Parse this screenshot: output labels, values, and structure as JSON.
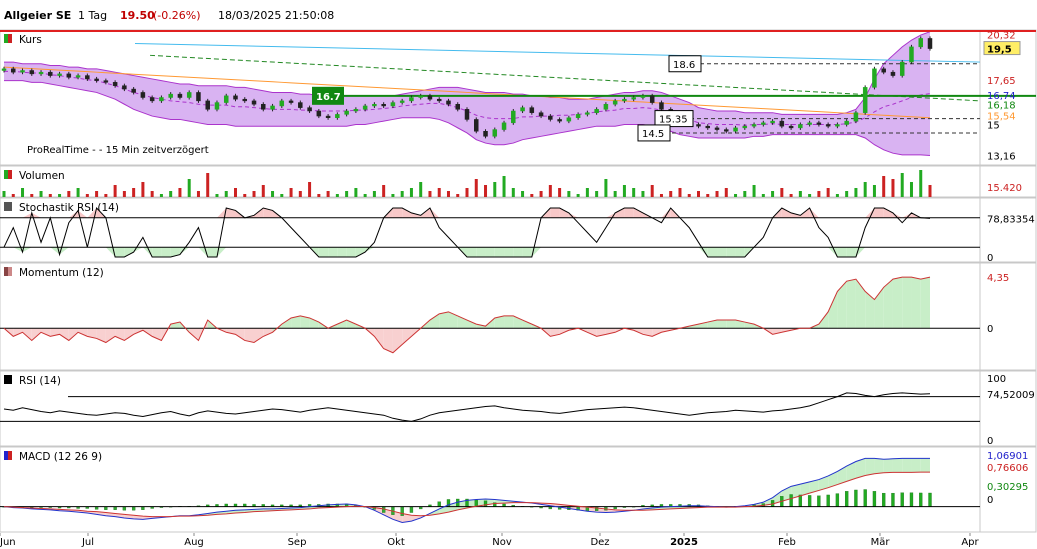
{
  "header": {
    "name": "Allgeier SE",
    "period": "1 Tag",
    "price": "19.50",
    "change": "(-0.26%)",
    "datetime": "18/03/2025 21:50:08"
  },
  "colors": {
    "up": "#22aa22",
    "down": "#cc2222",
    "bollinger_fill": "#cc99ee",
    "bollinger_line": "#aa33cc",
    "resistance": "#e02020",
    "support_green": "#118811",
    "trend_blue": "#44bbee",
    "orange_ma": "#ff9933",
    "stoch_hi_fill": "#f8c8c8",
    "stoch_lo_fill": "#c8eec8"
  },
  "chart_data": [
    {
      "type": "candlestick",
      "title": "Kurs",
      "source_note": "ProRealTime -     - 15 Min zeitverzögert",
      "x_labels": [
        "Jun",
        "Jul",
        "Aug",
        "Sep",
        "Okt",
        "Nov",
        "Dez",
        "2025",
        "Feb",
        "Mär",
        "Apr"
      ],
      "ylim": [
        12.6,
        20.6
      ],
      "y_scale_labels": [
        {
          "value": 20.32,
          "label": "20,32",
          "color": "#cc2222"
        },
        {
          "value": 19.5,
          "label": "19,5",
          "color": "#000000",
          "highlight": true
        },
        {
          "value": 17.65,
          "label": "17,65",
          "color": "#cc2222"
        },
        {
          "value": 16.74,
          "label": "16,74",
          "color": "#2222cc"
        },
        {
          "value": 16.18,
          "label": "16,18",
          "color": "#118811"
        },
        {
          "value": 15.54,
          "label": "15,54",
          "color": "#ff9933"
        },
        {
          "value": 15.0,
          "label": "15",
          "color": "#000000"
        },
        {
          "value": 13.16,
          "label": "13,16",
          "color": "#000000"
        }
      ],
      "annotations": [
        {
          "label": "16.7",
          "value": 16.7,
          "style": "green-box"
        },
        {
          "label": "18.6",
          "value": 18.6,
          "style": "box"
        },
        {
          "label": "15.35",
          "value": 15.35,
          "style": "box"
        },
        {
          "label": "14.5",
          "value": 14.5,
          "style": "box"
        }
      ],
      "lines": {
        "resistance": 20.6,
        "support": 16.7,
        "dashed_levels": [
          18.6,
          15.35,
          14.5
        ]
      },
      "close": [
        18.3,
        18.1,
        18.2,
        18.0,
        18.1,
        17.9,
        18.0,
        17.8,
        17.9,
        17.7,
        17.6,
        17.5,
        17.3,
        17.1,
        16.9,
        16.6,
        16.4,
        16.6,
        16.8,
        16.6,
        16.9,
        16.4,
        15.9,
        16.3,
        16.7,
        16.5,
        16.4,
        16.2,
        15.9,
        16.1,
        16.4,
        16.3,
        16.0,
        15.8,
        15.5,
        15.4,
        15.6,
        15.8,
        15.9,
        16.1,
        16.2,
        16.1,
        16.3,
        16.4,
        16.6,
        16.7,
        16.5,
        16.4,
        16.2,
        15.9,
        15.3,
        14.6,
        14.3,
        14.7,
        15.1,
        15.8,
        16.0,
        15.7,
        15.5,
        15.3,
        15.2,
        15.4,
        15.6,
        15.7,
        15.9,
        16.2,
        16.4,
        16.5,
        16.6,
        16.7,
        16.3,
        15.9,
        15.4,
        15.2,
        15.0,
        14.9,
        14.8,
        14.7,
        14.6,
        14.8,
        14.9,
        15.0,
        15.1,
        15.2,
        14.9,
        14.8,
        15.0,
        15.1,
        15.0,
        14.9,
        15.0,
        15.2,
        15.7,
        17.2,
        18.3,
        18.1,
        17.9,
        18.7,
        19.6,
        20.1,
        19.5
      ],
      "open": [
        18.2,
        18.3,
        18.1,
        18.2,
        18.0,
        18.1,
        17.9,
        18.0,
        17.8,
        17.9,
        17.7,
        17.6,
        17.5,
        17.3,
        17.1,
        16.9,
        16.6,
        16.4,
        16.6,
        16.8,
        16.6,
        16.9,
        16.4,
        15.9,
        16.3,
        16.7,
        16.5,
        16.4,
        16.2,
        15.9,
        16.1,
        16.4,
        16.3,
        16.0,
        15.8,
        15.5,
        15.4,
        15.6,
        15.8,
        15.9,
        16.1,
        16.2,
        16.1,
        16.3,
        16.4,
        16.6,
        16.7,
        16.5,
        16.4,
        16.2,
        15.9,
        15.3,
        14.6,
        14.3,
        14.7,
        15.1,
        15.8,
        16.0,
        15.7,
        15.5,
        15.3,
        15.2,
        15.4,
        15.6,
        15.7,
        15.9,
        16.2,
        16.4,
        16.5,
        16.6,
        16.7,
        16.3,
        15.9,
        15.4,
        15.2,
        15.0,
        14.9,
        14.8,
        14.7,
        14.6,
        14.8,
        14.9,
        15.0,
        15.1,
        15.2,
        14.9,
        14.8,
        15.0,
        15.1,
        15.0,
        14.9,
        15.0,
        15.2,
        15.7,
        17.2,
        18.3,
        18.1,
        17.9,
        18.7,
        19.6,
        20.1
      ],
      "bollinger_upper": [
        18.7,
        18.7,
        18.6,
        18.6,
        18.6,
        18.5,
        18.5,
        18.4,
        18.4,
        18.3,
        18.3,
        18.2,
        18.1,
        18.0,
        17.9,
        17.8,
        17.7,
        17.6,
        17.5,
        17.4,
        17.4,
        17.3,
        17.3,
        17.3,
        17.3,
        17.2,
        17.2,
        17.1,
        17.0,
        16.9,
        16.9,
        16.9,
        16.8,
        16.8,
        16.7,
        16.7,
        16.7,
        16.7,
        16.7,
        16.7,
        16.7,
        16.7,
        16.7,
        16.8,
        16.9,
        17.0,
        17.1,
        17.2,
        17.2,
        17.2,
        17.1,
        17.0,
        16.9,
        16.9,
        16.9,
        16.8,
        16.8,
        16.7,
        16.7,
        16.6,
        16.6,
        16.5,
        16.5,
        16.5,
        16.6,
        16.7,
        16.8,
        16.9,
        16.9,
        17.0,
        17.0,
        16.9,
        16.7,
        16.5,
        16.3,
        16.0,
        15.9,
        15.8,
        15.8,
        15.8,
        15.7,
        15.7,
        15.7,
        15.7,
        15.6,
        15.6,
        15.6,
        15.6,
        15.6,
        15.6,
        15.6,
        15.7,
        15.9,
        16.6,
        17.7,
        18.6,
        19.1,
        19.6,
        20.0,
        20.3,
        20.5
      ],
      "bollinger_lower": [
        17.6,
        17.6,
        17.6,
        17.5,
        17.5,
        17.4,
        17.3,
        17.2,
        17.1,
        17.0,
        16.9,
        16.7,
        16.5,
        16.2,
        15.9,
        15.7,
        15.5,
        15.4,
        15.3,
        15.3,
        15.2,
        15.1,
        15.0,
        15.0,
        15.0,
        14.9,
        14.9,
        14.9,
        14.9,
        14.9,
        14.9,
        14.9,
        14.9,
        14.9,
        14.9,
        14.9,
        14.9,
        14.9,
        15.0,
        15.0,
        15.1,
        15.2,
        15.3,
        15.4,
        15.4,
        15.4,
        15.4,
        15.3,
        15.1,
        14.8,
        14.5,
        14.1,
        13.9,
        13.8,
        13.8,
        13.9,
        14.1,
        14.2,
        14.3,
        14.4,
        14.5,
        14.6,
        14.7,
        14.8,
        14.9,
        14.9,
        14.9,
        15.0,
        15.0,
        15.0,
        14.9,
        14.8,
        14.6,
        14.4,
        14.3,
        14.2,
        14.2,
        14.2,
        14.2,
        14.2,
        14.2,
        14.3,
        14.3,
        14.4,
        14.4,
        14.4,
        14.4,
        14.4,
        14.4,
        14.4,
        14.4,
        14.4,
        14.4,
        14.2,
        13.8,
        13.5,
        13.3,
        13.2,
        13.2,
        13.2,
        13.16
      ],
      "volume": [
        2,
        1,
        3,
        1,
        2,
        1,
        1,
        2,
        3,
        1,
        2,
        1,
        4,
        2,
        3,
        5,
        2,
        1,
        2,
        3,
        6,
        2,
        8,
        1,
        2,
        3,
        1,
        2,
        4,
        2,
        1,
        3,
        2,
        5,
        1,
        2,
        1,
        2,
        3,
        1,
        2,
        4,
        1,
        2,
        3,
        5,
        2,
        3,
        2,
        1,
        3,
        6,
        4,
        5,
        7,
        3,
        2,
        1,
        2,
        4,
        3,
        2,
        1,
        3,
        2,
        6,
        2,
        4,
        3,
        2,
        4,
        1,
        2,
        3,
        1,
        2,
        1,
        2,
        3,
        1,
        2,
        4,
        1,
        2,
        3,
        1,
        2,
        1,
        2,
        3,
        1,
        2,
        3,
        5,
        4,
        7,
        6,
        8,
        5,
        9,
        4
      ],
      "volume_label": "15.420"
    },
    {
      "type": "line",
      "title": "Stochastik RSI (14)",
      "ylim": [
        0,
        100
      ],
      "levels": [
        80,
        20
      ],
      "y_scale_labels": [
        {
          "value": 78.83354,
          "label": "78,83354"
        },
        {
          "value": 0,
          "label": "0"
        }
      ],
      "values": [
        20,
        60,
        10,
        90,
        30,
        80,
        5,
        70,
        95,
        20,
        100,
        80,
        0,
        0,
        10,
        40,
        0,
        0,
        0,
        5,
        30,
        60,
        0,
        0,
        100,
        95,
        80,
        85,
        100,
        95,
        80,
        60,
        40,
        20,
        0,
        0,
        0,
        0,
        0,
        10,
        30,
        80,
        100,
        100,
        90,
        85,
        100,
        60,
        40,
        20,
        0,
        0,
        0,
        0,
        0,
        0,
        0,
        0,
        80,
        100,
        100,
        90,
        70,
        50,
        30,
        60,
        90,
        100,
        100,
        90,
        80,
        70,
        100,
        80,
        60,
        30,
        0,
        0,
        0,
        0,
        0,
        20,
        40,
        80,
        100,
        90,
        85,
        100,
        60,
        40,
        0,
        0,
        0,
        60,
        100,
        100,
        90,
        70,
        90,
        80,
        78.8
      ]
    },
    {
      "type": "area",
      "title": "Momentum (12)",
      "ylim": [
        -0.9,
        1.35
      ],
      "baseline": 0,
      "y_scale_labels": [
        {
          "value": 1.25,
          "label": "4,35"
        },
        {
          "value": 0,
          "label": "0"
        }
      ],
      "values": [
        0.0,
        -0.2,
        -0.1,
        -0.3,
        -0.1,
        -0.2,
        -0.15,
        -0.3,
        -0.1,
        -0.2,
        -0.25,
        -0.35,
        -0.2,
        -0.3,
        -0.15,
        -0.05,
        -0.2,
        -0.3,
        0.1,
        0.15,
        -0.1,
        -0.3,
        0.2,
        0.0,
        -0.1,
        -0.15,
        -0.3,
        -0.35,
        -0.2,
        -0.1,
        0.1,
        0.25,
        0.3,
        0.25,
        0.15,
        0.0,
        0.1,
        0.2,
        0.1,
        0.0,
        -0.2,
        -0.5,
        -0.6,
        -0.4,
        -0.2,
        0.0,
        0.2,
        0.35,
        0.4,
        0.3,
        0.2,
        0.1,
        0.05,
        0.25,
        0.3,
        0.3,
        0.2,
        0.1,
        0.0,
        -0.2,
        -0.15,
        -0.05,
        0.0,
        -0.1,
        -0.2,
        -0.15,
        -0.1,
        0.0,
        -0.05,
        -0.15,
        -0.2,
        -0.1,
        -0.05,
        0.0,
        0.05,
        0.1,
        0.15,
        0.2,
        0.2,
        0.2,
        0.15,
        0.1,
        0.0,
        -0.15,
        -0.1,
        -0.05,
        0.0,
        0.0,
        0.1,
        0.4,
        0.9,
        1.15,
        1.2,
        0.9,
        0.7,
        1.0,
        1.2,
        1.25,
        1.25,
        1.2,
        1.25
      ]
    },
    {
      "type": "line",
      "title": "RSI (14)",
      "ylim": [
        0,
        100
      ],
      "levels": [
        70,
        30
      ],
      "y_scale_labels": [
        {
          "value": 100,
          "label": "100"
        },
        {
          "value": 74.52009,
          "label": "74,52009"
        },
        {
          "value": 0,
          "label": "0"
        }
      ],
      "values": [
        50,
        48,
        52,
        49,
        46,
        44,
        47,
        45,
        43,
        41,
        40,
        42,
        44,
        43,
        40,
        38,
        41,
        44,
        46,
        42,
        39,
        44,
        47,
        45,
        43,
        42,
        44,
        46,
        48,
        50,
        49,
        47,
        45,
        48,
        50,
        52,
        50,
        48,
        46,
        44,
        42,
        40,
        35,
        32,
        30,
        34,
        40,
        44,
        46,
        48,
        50,
        52,
        54,
        55,
        52,
        50,
        48,
        47,
        46,
        44,
        43,
        45,
        47,
        49,
        50,
        51,
        52,
        53,
        52,
        50,
        48,
        46,
        44,
        42,
        40,
        42,
        44,
        45,
        46,
        48,
        47,
        46,
        45,
        47,
        48,
        50,
        52,
        55,
        60,
        65,
        70,
        76,
        75,
        72,
        70,
        73,
        75,
        76,
        75,
        74,
        74.5
      ]
    },
    {
      "type": "bar+line",
      "title": "MACD (12 26 9)",
      "ylim": [
        -0.45,
        1.1
      ],
      "y_scale_labels": [
        {
          "value": 1.06901,
          "label": "1,06901",
          "color": "#2222cc"
        },
        {
          "value": 0.76606,
          "label": "0,76606",
          "color": "#cc2222"
        },
        {
          "value": 0.30295,
          "label": "0,30295",
          "color": "#118811"
        },
        {
          "value": 0,
          "label": "0",
          "color": "#000000"
        }
      ],
      "macd": [
        0.0,
        -0.02,
        -0.03,
        -0.05,
        -0.06,
        -0.07,
        -0.09,
        -0.1,
        -0.12,
        -0.14,
        -0.17,
        -0.2,
        -0.22,
        -0.25,
        -0.27,
        -0.28,
        -0.26,
        -0.24,
        -0.22,
        -0.2,
        -0.2,
        -0.18,
        -0.15,
        -0.12,
        -0.1,
        -0.08,
        -0.07,
        -0.06,
        -0.05,
        -0.05,
        -0.04,
        -0.03,
        -0.02,
        0.0,
        0.02,
        0.04,
        0.05,
        0.06,
        0.04,
        0.0,
        -0.08,
        -0.18,
        -0.28,
        -0.35,
        -0.32,
        -0.25,
        -0.15,
        -0.05,
        0.04,
        0.1,
        0.14,
        0.16,
        0.17,
        0.16,
        0.14,
        0.12,
        0.1,
        0.08,
        0.05,
        0.02,
        -0.01,
        -0.04,
        -0.07,
        -0.1,
        -0.12,
        -0.13,
        -0.12,
        -0.1,
        -0.08,
        -0.05,
        -0.03,
        -0.01,
        0.0,
        0.01,
        0.02,
        0.02,
        0.01,
        0.0,
        -0.01,
        0.0,
        0.02,
        0.05,
        0.1,
        0.2,
        0.35,
        0.45,
        0.5,
        0.55,
        0.6,
        0.68,
        0.78,
        0.9,
        1.0,
        1.07,
        1.07,
        1.05,
        1.06,
        1.07,
        1.07,
        1.07,
        1.069
      ],
      "signal": [
        0.0,
        -0.01,
        -0.02,
        -0.03,
        -0.04,
        -0.05,
        -0.06,
        -0.07,
        -0.08,
        -0.1,
        -0.11,
        -0.13,
        -0.15,
        -0.17,
        -0.19,
        -0.21,
        -0.22,
        -0.22,
        -0.22,
        -0.21,
        -0.21,
        -0.2,
        -0.19,
        -0.17,
        -0.16,
        -0.14,
        -0.13,
        -0.11,
        -0.1,
        -0.09,
        -0.08,
        -0.07,
        -0.06,
        -0.05,
        -0.03,
        -0.02,
        -0.01,
        0.0,
        0.01,
        0.0,
        -0.02,
        -0.05,
        -0.1,
        -0.15,
        -0.19,
        -0.2,
        -0.19,
        -0.16,
        -0.12,
        -0.07,
        -0.03,
        0.01,
        0.04,
        0.07,
        0.08,
        0.09,
        0.09,
        0.09,
        0.08,
        0.07,
        0.05,
        0.03,
        0.01,
        -0.01,
        -0.03,
        -0.05,
        -0.07,
        -0.08,
        -0.08,
        -0.08,
        -0.07,
        -0.06,
        -0.05,
        -0.04,
        -0.03,
        -0.02,
        -0.01,
        -0.01,
        -0.01,
        -0.01,
        0.0,
        0.01,
        0.03,
        0.06,
        0.12,
        0.18,
        0.24,
        0.3,
        0.36,
        0.42,
        0.49,
        0.56,
        0.63,
        0.69,
        0.73,
        0.75,
        0.76,
        0.76,
        0.76,
        0.766,
        0.766
      ],
      "histogram_label": "0,30295"
    }
  ]
}
